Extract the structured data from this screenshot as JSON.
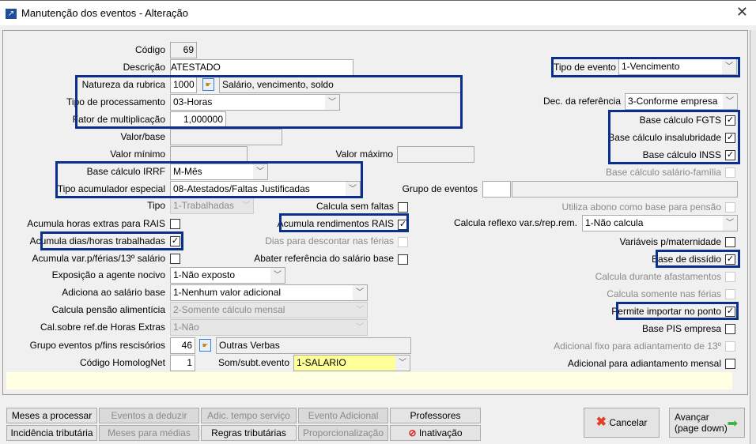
{
  "window": {
    "title": "Manutenção dos eventos - Alteração",
    "close": "✕"
  },
  "fields": {
    "codigo": {
      "label": "Código",
      "value": "69"
    },
    "descricao": {
      "label": "Descrição",
      "value": "ATESTADO"
    },
    "natureza": {
      "label": "Natureza da rubrica",
      "value": "1000",
      "desc": "Salário, vencimento, soldo"
    },
    "tipo_processamento": {
      "label": "Tipo de processamento",
      "value": "03-Horas"
    },
    "fator": {
      "label": "Fator de multiplicação",
      "value": "1,000000"
    },
    "valor_base": {
      "label": "Valor/base",
      "value": ""
    },
    "valor_minimo": {
      "label": "Valor mínimo",
      "value": ""
    },
    "valor_maximo": {
      "label": "Valor máximo",
      "value": ""
    },
    "base_irrf": {
      "label": "Base cálculo IRRF",
      "value": "M-Mês"
    },
    "tipo_acumulador": {
      "label": "Tipo acumulador especial",
      "value": "08-Atestados/Faltas Justificadas"
    },
    "tipo": {
      "label": "Tipo",
      "value": "1-Trabalhadas"
    },
    "exposicao": {
      "label": "Exposição a agente nocivo",
      "value": "1-Não exposto"
    },
    "adiciona": {
      "label": "Adiciona ao salário base",
      "value": "1-Nenhum valor adicional"
    },
    "pensao": {
      "label": "Calcula pensão alimentícia",
      "value": "2-Somente cálculo mensal"
    },
    "cal_sobre": {
      "label": "Cal.sobre ref.de Horas Extras",
      "value": "1-Não"
    },
    "grupo_resc": {
      "label": "Grupo eventos p/fins rescisórios",
      "value": "46",
      "desc": "Outras Verbas"
    },
    "homolognet": {
      "label": "Código HomologNet",
      "value": "1"
    },
    "som_subt": {
      "label": "Som/subt.evento",
      "value": "1-SALARIO"
    },
    "tipo_evento": {
      "label": "Tipo de evento",
      "value": "1-Vencimento"
    },
    "dec_referencia": {
      "label": "Dec. da referência",
      "value": "3-Conforme empresa"
    },
    "grupo_eventos": {
      "label": "Grupo de eventos",
      "value": "",
      "desc": ""
    },
    "calcula_reflexo": {
      "label": "Calcula reflexo var.s/rep.rem.",
      "value": "1-Não calcula"
    }
  },
  "checks": {
    "horas_extras_rais": {
      "label": "Acumula horas extras para RAIS",
      "checked": false
    },
    "dias_horas": {
      "label": "Acumula dias/horas trabalhadas",
      "checked": true
    },
    "var_ferias": {
      "label": "Acumula var.p/férias/13º salário",
      "checked": false
    },
    "sem_faltas": {
      "label": "Calcula sem faltas",
      "checked": false
    },
    "rend_rais": {
      "label": "Acumula rendimentos RAIS",
      "checked": true
    },
    "dias_descontar": {
      "label": "Dias para descontar nas férias",
      "checked": false
    },
    "abater": {
      "label": "Abater referência do salário base",
      "checked": false
    },
    "fgts": {
      "label": "Base cálculo FGTS",
      "checked": true
    },
    "insalubridade": {
      "label": "Base cálculo insalubridade",
      "checked": true
    },
    "inss": {
      "label": "Base cálculo INSS",
      "checked": true
    },
    "salario_familia": {
      "label": "Base cálculo salário-família",
      "checked": false
    },
    "abono_pensao": {
      "label": "Utiliza abono como base para pensão",
      "checked": false
    },
    "maternidade": {
      "label": "Variáveis p/maternidade",
      "checked": false
    },
    "dissidio": {
      "label": "Base de dissídio",
      "checked": true
    },
    "afastamentos": {
      "label": "Calcula durante afastamentos",
      "checked": false
    },
    "somente_ferias": {
      "label": "Calcula somente nas férias",
      "checked": false
    },
    "importar_ponto": {
      "label": "Permite importar no ponto",
      "checked": true
    },
    "pis": {
      "label": "Base PIS empresa",
      "checked": false
    },
    "adic_fixo_13": {
      "label": "Adicional fixo para adiantamento de 13º",
      "checked": false
    },
    "adic_mensal": {
      "label": "Adicional para adiantamento mensal",
      "checked": false
    }
  },
  "buttons": {
    "meses_processar": "Meses a processar",
    "eventos_deduzir": "Eventos a deduzir",
    "adic_tempo": "Adic. tempo serviço",
    "evento_adicional": "Evento Adicional",
    "professores": "Professores",
    "incidencia": "Incidência tributária",
    "meses_medias": "Meses para médias",
    "regras": "Regras tributárias",
    "proporcionalizacao": "Proporcionalização",
    "inativacao": "Inativação",
    "cancelar": "Cancelar",
    "avancar": "Avançar",
    "avancar_sub": "(page down)"
  },
  "colors": {
    "highlight": "#0a2f8c",
    "yellow_field": "#ffff99",
    "info_bar": "#ffffe1"
  }
}
